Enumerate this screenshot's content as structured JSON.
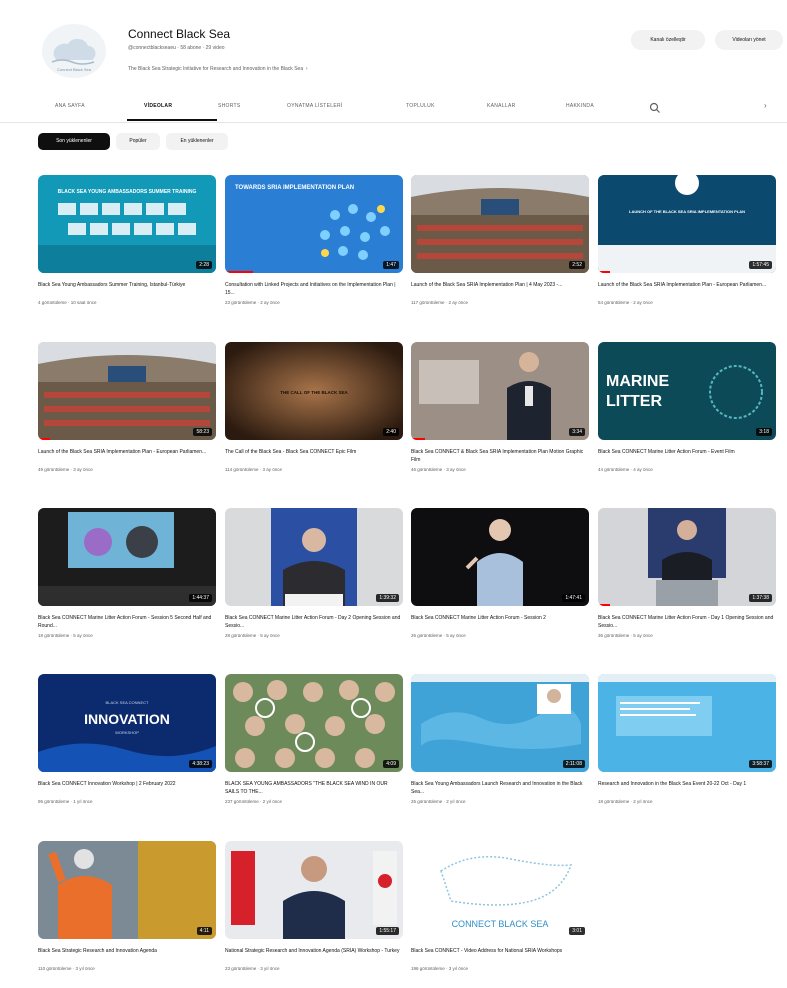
{
  "channel": {
    "name": "Connect Black Sea",
    "meta": "@connectblackseaeu · 58 abone · 29 video",
    "description": "The Black Sea Strategic Initiative for Research and Innovation in the Black Sea",
    "buttons": [
      "Kanalı özelleştir",
      "Videoları yönet"
    ]
  },
  "tabs": [
    "ANA SAYFA",
    "VİDEOLAR",
    "SHORTS",
    "OYNATMA LİSTELERİ",
    "TOPLULUK",
    "KANALLAR",
    "HAKKINDA"
  ],
  "chips": [
    "Son yüklenenler",
    "Popüler",
    "En yüklenenler"
  ],
  "videos": [
    {
      "title": "Black Sea Young Ambassadors Summer Training, Istanbul-Türkiye",
      "meta": "4 görüntüleme · 10 saat önce",
      "duration": "2:28"
    },
    {
      "title": "Consultation with Linked Projects and Initiatives on the Implementation Plan | 15...",
      "meta": "23 görüntüleme · 2 ay önce",
      "duration": "1:47"
    },
    {
      "title": "Launch of the Black Sea SRIA Implementation Plan | 4 May 2023 -...",
      "meta": "117 görüntüleme · 2 ay önce",
      "duration": "2:52"
    },
    {
      "title": "Launch of the Black Sea SRIA Implementation Plan - European Parliamen...",
      "meta": "54 görüntüleme · 2 ay önce",
      "duration": "1:57:45"
    },
    {
      "title": "Launch of the Black Sea SRIA Implementation Plan - European Parliamen...",
      "meta": "49 görüntüleme · 3 ay önce",
      "duration": "58:23"
    },
    {
      "title": "The Call of the Black Sea - Black Sea CONNECT Epic Film",
      "meta": "114 görüntüleme · 3 ay önce",
      "duration": "2:40"
    },
    {
      "title": "Black Sea CONNECT & Black Sea SRIA Implementation Plan Motion Graphic Film",
      "meta": "46 görüntüleme · 3 ay önce",
      "duration": "3:34"
    },
    {
      "title": "Black Sea CONNECT Marine Litter Action Forum - Event Film",
      "meta": "44 görüntüleme · 4 ay önce",
      "duration": "3:18"
    },
    {
      "title": "Black Sea CONNECT Marine Litter Action Forum - Session 5 Second Half and Round...",
      "meta": "18 görüntüleme · 5 ay önce",
      "duration": "1:44:37"
    },
    {
      "title": "Black Sea CONNECT Marine Litter Action Forum - Day 2 Opening Session and Sessio...",
      "meta": "28 görüntüleme · 5 ay önce",
      "duration": "1:39:32"
    },
    {
      "title": "Black Sea CONNECT Marine Litter Action Forum - Session 2",
      "meta": "26 görüntüleme · 5 ay önce",
      "duration": "1:47:41"
    },
    {
      "title": "Black Sea CONNECT Marine Litter Action Forum - Day 1 Opening Session and Sessio...",
      "meta": "36 görüntüleme · 5 ay önce",
      "duration": "1:37:38"
    },
    {
      "title": "Black Sea CONNECT Innovation Workshop | 2 February 2022",
      "meta": "95 görüntüleme · 1 yıl önce",
      "duration": "4:38:23"
    },
    {
      "title": "BLACK SEA YOUNG AMBASSADORS \"THE BLACK SEA WIND IN OUR SAILS TO THE...",
      "meta": "237 görüntüleme · 2 yıl önce",
      "duration": "4:09"
    },
    {
      "title": "Black Sea Young Ambassadors Launch Research and Innovation in the Black Sea...",
      "meta": "26 görüntüleme · 2 yıl önce",
      "duration": "2:11:08"
    },
    {
      "title": "Research and Innovation in the Black Sea Event 20-22 Oct - Day 1",
      "meta": "18 görüntüleme · 2 yıl önce",
      "duration": "3:58:37"
    },
    {
      "title": "Black Sea Strategic Research and Innovation Agenda",
      "meta": "110 görüntüleme · 3 yıl önce",
      "duration": "4:11"
    },
    {
      "title": "National Strategic Research and Innovation Agenda (SRIA) Workshop - Turkey",
      "meta": "23 görüntüleme · 3 yıl önce",
      "duration": "1:55:17"
    },
    {
      "title": "Black Sea CONNECT - Video Address for National SRIA Workshops",
      "meta": "196 görüntüleme · 3 yıl önce",
      "duration": "3:01"
    }
  ],
  "thumb_texts": {
    "v0": "BLACK SEA YOUNG AMBASSADORS SUMMER TRAINING",
    "v1": "TOWARDS SRIA IMPLEMENTATION PLAN",
    "v3": "LAUNCH OF THE BLACK SEA SRIA IMPLEMENTATION PLAN",
    "v5": "THE CALL OF THE BLACK SEA",
    "v7a": "MARINE",
    "v7b": "LITTER",
    "v12a": "BLACK SEA CONNECT",
    "v12b": "INNOVATION",
    "v12c": "WORKSHOP",
    "v18": "CONNECT BLACK SEA"
  },
  "colors": {
    "accent": "#0f0f0f",
    "progress": "#ff0000",
    "chip_bg": "#f2f2f2",
    "muted_text": "#606060"
  },
  "icons": [
    "search-icon",
    "chevron-right-icon",
    "chevron-right-more-icon",
    "channel-logo-icon"
  ]
}
